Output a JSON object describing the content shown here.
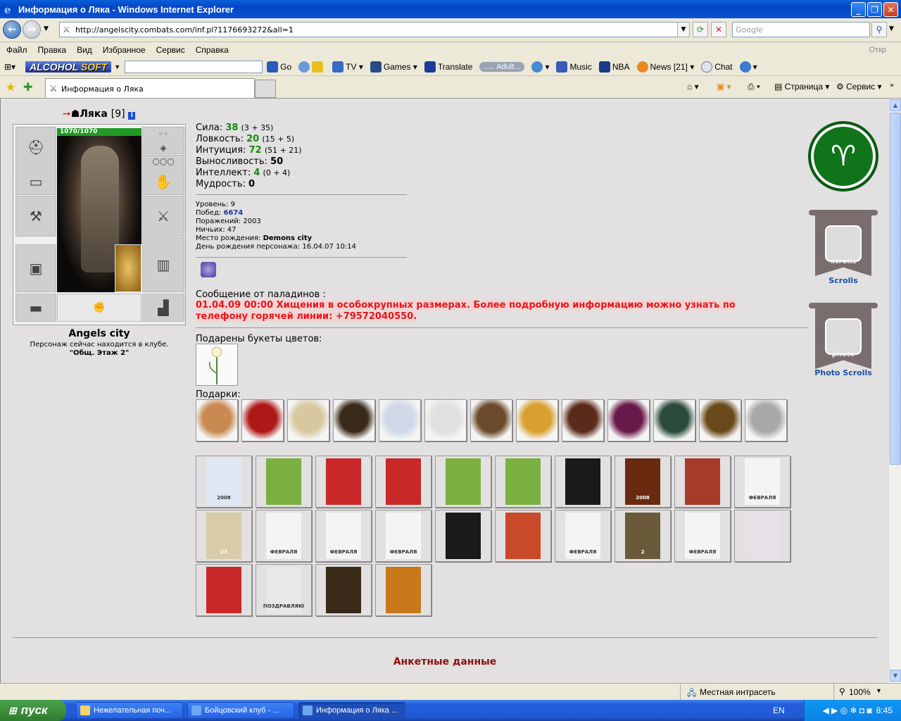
{
  "window": {
    "title": "Информация о Ляка - Windows Internet Explorer"
  },
  "browser": {
    "url": "http://angelscity.combats.com/inf.pl?1176693272&all=1",
    "search_placeholder": "Google",
    "menu": [
      "Файл",
      "Правка",
      "Вид",
      "Избранное",
      "Сервис",
      "Справка"
    ],
    "menu_right": "Откр",
    "toolbar": {
      "brand_a": "ALCOHOL",
      "brand_b": "SOFT",
      "go": "Go",
      "tv": "TV",
      "games": "Games",
      "translate": "Translate",
      "radio": "..... Adult...",
      "music": "Music",
      "nba": "NBA",
      "news": "News",
      "news_count": "[21]",
      "chat": "Chat"
    },
    "tab_title": "Информация о Ляка",
    "page_menu": "Страница",
    "tools_menu": "Сервис"
  },
  "character": {
    "name": "Ляка",
    "level_tag": "[9]",
    "hp": "1070/1070",
    "city": "Angels city",
    "location_line": "Персонаж сейчас находится в клубе.",
    "location_room": "\"Общ. Этаж 2\""
  },
  "stats": [
    {
      "label": "Сила:",
      "value": "38",
      "extra": "(3 + 35)",
      "color": "green"
    },
    {
      "label": "Ловкость:",
      "value": "20",
      "extra": "(15 + 5)",
      "color": "green"
    },
    {
      "label": "Интуиция:",
      "value": "72",
      "extra": "(51 + 21)",
      "color": "green"
    },
    {
      "label": "Выносливость:",
      "value": "50",
      "extra": "",
      "color": "black"
    },
    {
      "label": "Интеллект:",
      "value": "4",
      "extra": "(0 + 4)",
      "color": "green"
    },
    {
      "label": "Мудрость:",
      "value": "0",
      "extra": "",
      "color": "black"
    }
  ],
  "details": {
    "level_label": "Уровень:",
    "level": "9",
    "wins_label": "Побед:",
    "wins": "6674",
    "losses_label": "Поражений:",
    "losses": "2003",
    "draws_label": "Ничьих:",
    "draws": "47",
    "birthplace_label": "Место рождения:",
    "birthplace": "Demons city",
    "birthday_label": "День рождения персонажа:",
    "birthday": "16.04.07 10:14"
  },
  "message": {
    "label": "Сообщение от паладинов :",
    "text": "01.04.09 00:00 Хищения в особокрупных размерах. Более подробную информацию можно узнать по телефону горячей линии: +79572040550."
  },
  "bouquets_label": "Подарены букеты цветов:",
  "gifts_label": "Подарки:",
  "side": {
    "scrolls_word": "scrolls",
    "scrolls": "Scrolls",
    "photo_word": "photo",
    "photo_scrolls": "Photo Scrolls"
  },
  "card_texts": {
    "year": "2008",
    "feb": "ФЕВРАЛЯ",
    "congrats": "ПОЗДРАВЛЯЮ",
    "yr2": "2008",
    "num2": "2",
    "num23": "23"
  },
  "section_title": "Анкетные данные",
  "status": {
    "zone": "Местная интрасеть",
    "zoom": "100%"
  },
  "taskbar": {
    "start": "пуск",
    "tasks": [
      "Нежелательная поч...",
      "Бойцовский клуб - ...",
      "Информация о Ляка ..."
    ],
    "lang": "EN",
    "clock": "8:45"
  },
  "colors": {
    "stat_green": "#118a11",
    "alert_red": "#e8141a",
    "link_blue": "#1a4fa8",
    "section_red": "#8a1010"
  }
}
